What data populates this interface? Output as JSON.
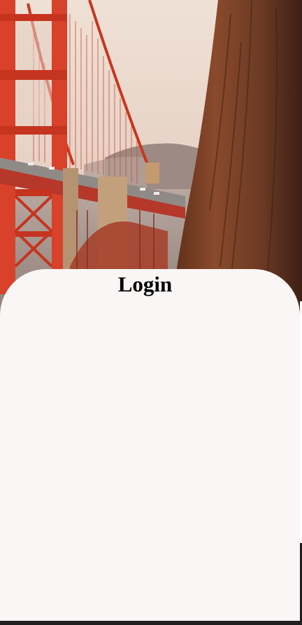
{
  "background": {
    "icon": "golden-gate-bridge-photo"
  },
  "login": {
    "title": "Login"
  },
  "colors": {
    "sheet": "#faf6f5",
    "title": "#000000",
    "bridge": "#d9412a",
    "sky": "#e8d6cb",
    "tree": "#6b3a24"
  }
}
